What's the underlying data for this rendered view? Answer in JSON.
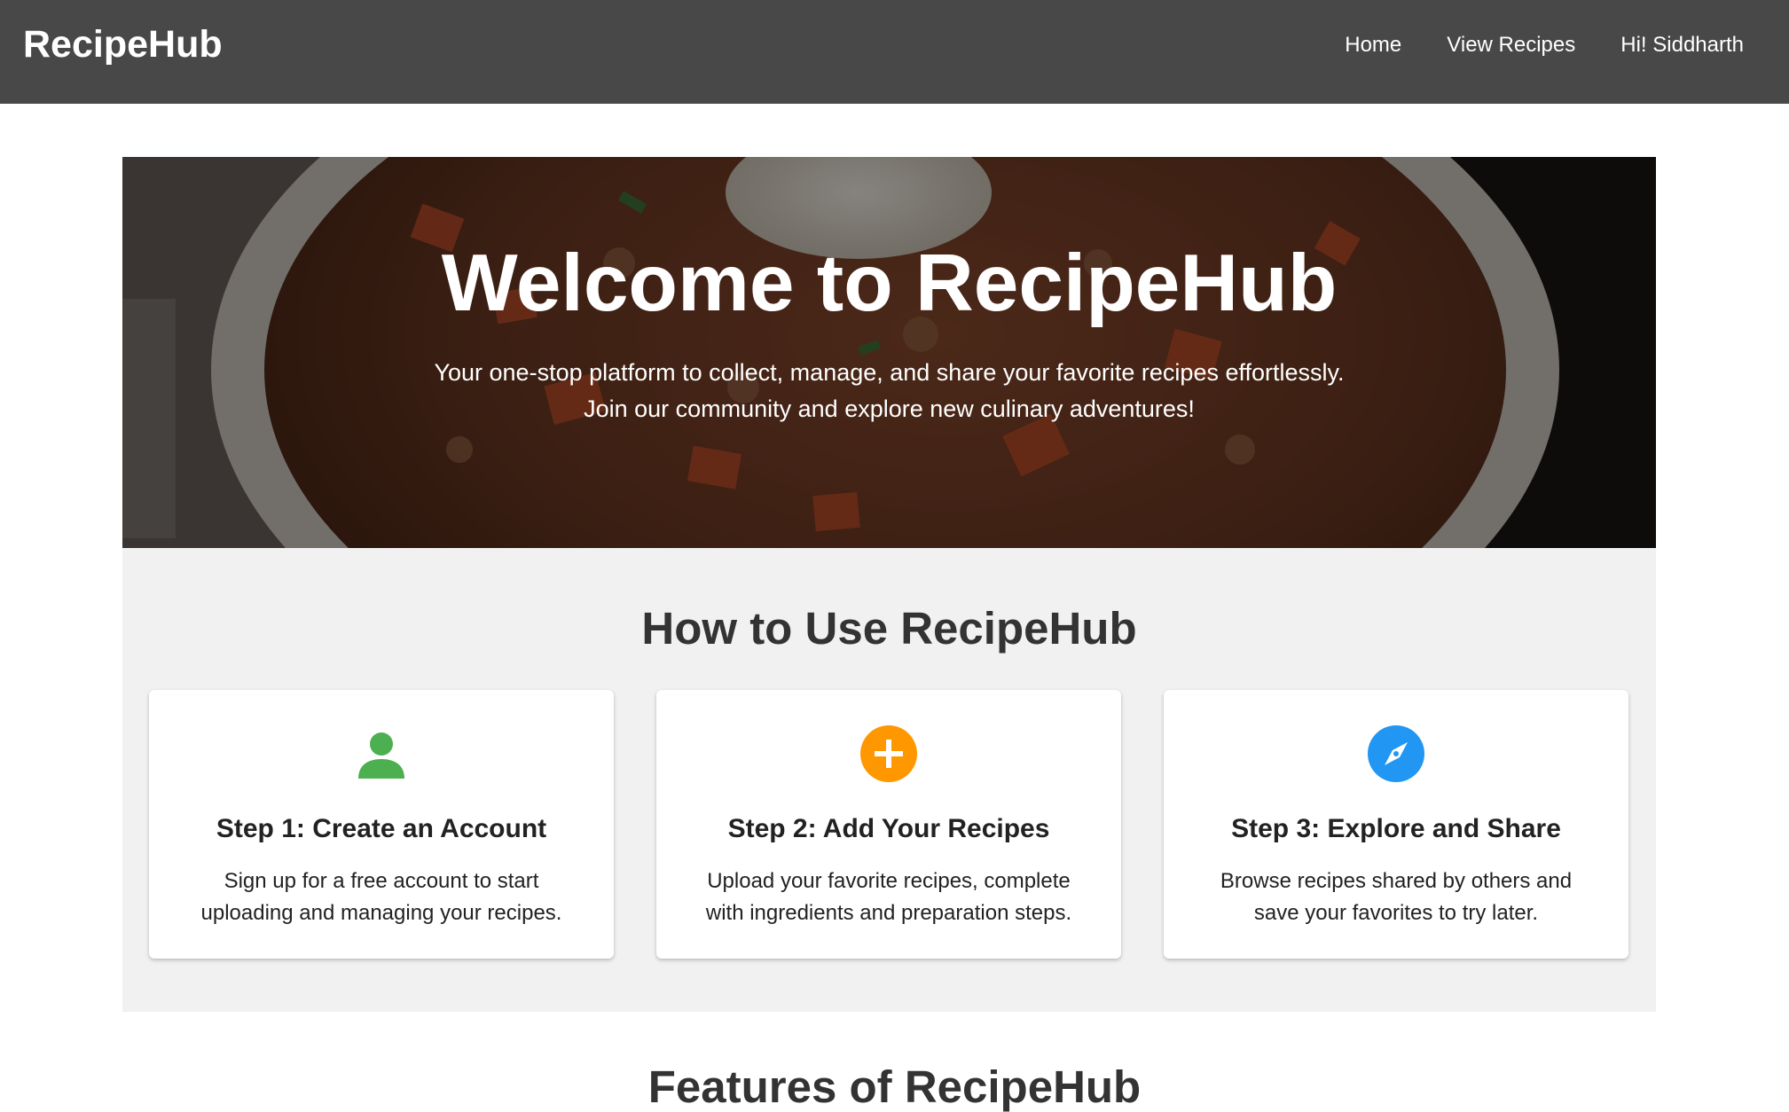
{
  "header": {
    "brand": "RecipeHub",
    "nav": [
      {
        "label": "Home"
      },
      {
        "label": "View Recipes"
      },
      {
        "label": "Hi! Siddharth"
      }
    ]
  },
  "hero": {
    "title": "Welcome to RecipeHub",
    "subtitle_line1": "Your one-stop platform to collect, manage, and share your favorite recipes effortlessly.",
    "subtitle_line2": "Join our community and explore new culinary adventures!"
  },
  "how_to": {
    "title": "How to Use RecipeHub",
    "steps": [
      {
        "icon": "user-icon",
        "icon_color": "#4caf50",
        "title": "Step 1: Create an Account",
        "desc_line1": "Sign up for a free account to start",
        "desc_line2": "uploading and managing your recipes."
      },
      {
        "icon": "plus-circle-icon",
        "icon_color": "#ff9800",
        "title": "Step 2: Add Your Recipes",
        "desc_line1": "Upload your favorite recipes, complete",
        "desc_line2": "with ingredients and preparation steps."
      },
      {
        "icon": "compass-icon",
        "icon_color": "#2196f3",
        "title": "Step 3: Explore and Share",
        "desc_line1": "Browse recipes shared by others and",
        "desc_line2": "save your favorites to try later."
      }
    ]
  },
  "features": {
    "title": "Features of RecipeHub"
  },
  "colors": {
    "header_bg": "#484848",
    "section_bg": "#f1f1f1",
    "heading_text": "#333333"
  }
}
